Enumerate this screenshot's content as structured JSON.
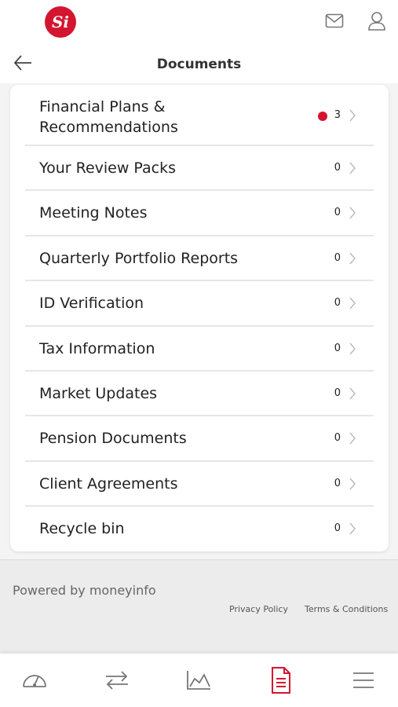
{
  "header": {
    "logo_text": "Si",
    "icons": [
      "mail-icon",
      "user-icon"
    ]
  },
  "subheader": {
    "back_icon": "arrow-left-icon",
    "title": "Documents"
  },
  "documents": [
    {
      "label_line1": "Financial Plans &",
      "label_line2": "Recommendations",
      "count": "3",
      "has_new": true
    },
    {
      "label": "Your Review Packs",
      "count": "0"
    },
    {
      "label": "Meeting Notes",
      "count": "0"
    },
    {
      "label": "Quarterly Portfolio Reports",
      "count": "0"
    },
    {
      "label": "ID Verification",
      "count": "0"
    },
    {
      "label": "Tax Information",
      "count": "0"
    },
    {
      "label": "Market Updates",
      "count": "0"
    },
    {
      "label": "Pension Documents",
      "count": "0"
    },
    {
      "label": "Client Agreements",
      "count": "0"
    },
    {
      "label": "Recycle bin",
      "count": "0"
    }
  ],
  "footer": {
    "powered_by": "Powered by moneyinfo",
    "privacy": "Privacy Policy",
    "terms": "Terms & Conditions"
  },
  "tabbar": {
    "tabs": [
      "dashboard-icon",
      "transfer-icon",
      "chart-icon",
      "document-icon",
      "menu-icon"
    ],
    "active": "document-icon"
  },
  "colors": {
    "brand_red": "#d4152f",
    "footer_bg": "#ececec"
  }
}
